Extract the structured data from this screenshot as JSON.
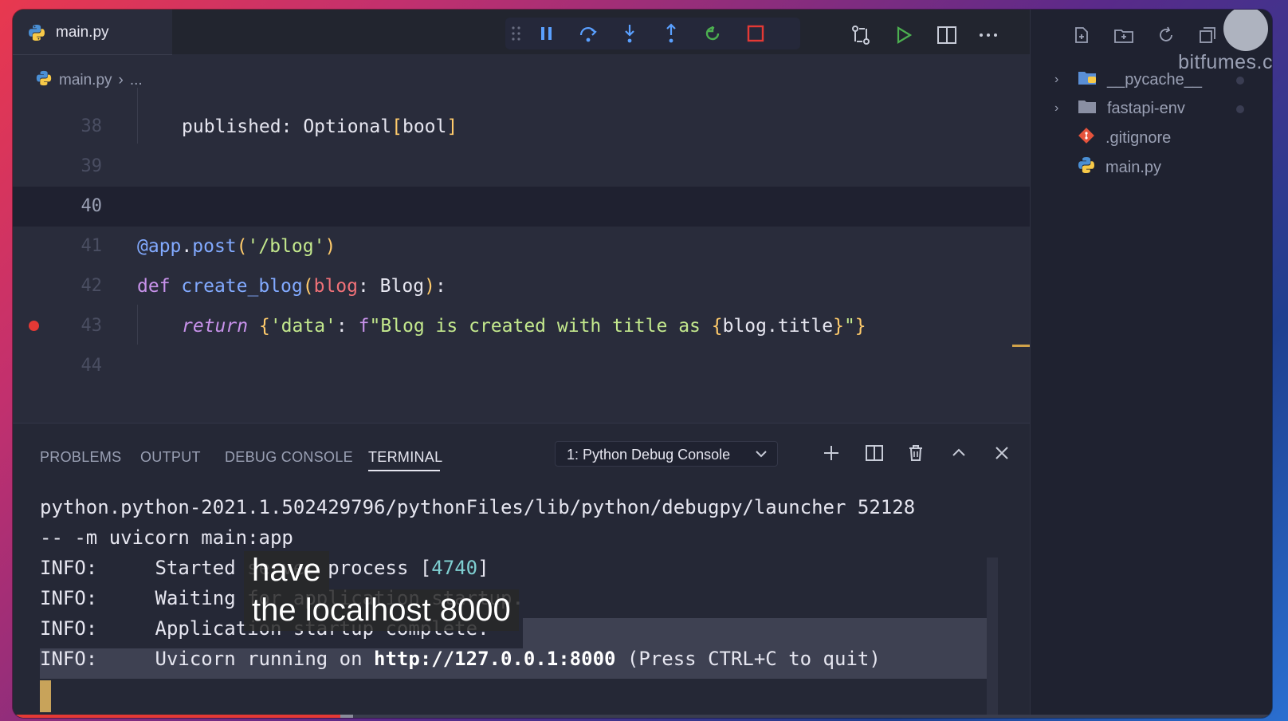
{
  "editor": {
    "tab_label": "main.py",
    "breadcrumb": {
      "file": "main.py",
      "more": "..."
    },
    "lines": [
      {
        "num": "38",
        "text": "published: Optional[bool]"
      },
      {
        "num": "39",
        "text": ""
      },
      {
        "num": "40",
        "text": ""
      },
      {
        "num": "41",
        "text": "@app.post('/blog')"
      },
      {
        "num": "42",
        "text": "def create_blog(blog: Blog):"
      },
      {
        "num": "43",
        "text": "return {'data': f\"Blog is created with title as {blog.title}\"}"
      },
      {
        "num": "44",
        "text": ""
      }
    ],
    "current_line": "40",
    "breakpoint_line": "43"
  },
  "debug_toolbar": {
    "items": [
      "drag-handle-icon",
      "pause-icon",
      "step-over-icon",
      "step-into-icon",
      "step-out-icon",
      "restart-icon",
      "stop-icon"
    ]
  },
  "title_actions": [
    "compare-changes-icon",
    "run-icon",
    "split-editor-icon",
    "more-actions-icon"
  ],
  "explorer": {
    "brand": "bitfumes.c",
    "items": [
      {
        "name": "__pycache__",
        "type": "folder",
        "expandable": true
      },
      {
        "name": "fastapi-env",
        "type": "folder",
        "expandable": true
      },
      {
        "name": ".gitignore",
        "type": "git"
      },
      {
        "name": "main.py",
        "type": "python"
      }
    ]
  },
  "panel": {
    "tabs": [
      "PROBLEMS",
      "OUTPUT",
      "DEBUG CONSOLE",
      "TERMINAL"
    ],
    "active_tab": "TERMINAL",
    "terminal_select": "1: Python Debug Console",
    "terminal_lines": {
      "l1": "python.python-2021.1.502429796/pythonFiles/lib/python/debugpy/launcher 52128",
      "l2": "-- -m uvicorn main:app",
      "l3_prefix": "INFO:     Started ",
      "l3_hidden": "server",
      "l3_mid": " process [",
      "l3_num": "4740",
      "l3_end": "]",
      "l4": "INFO:     Waiting for application startup.",
      "l5": "INFO:     Application startup complete.",
      "l6_prefix": "INFO:     Uvicorn running on ",
      "l6_url": "http://127.0.0.1:8000",
      "l6_suffix": " (Press CTRL+C to quit)"
    }
  },
  "captions": {
    "line1": "have",
    "line2": "the localhost 8000"
  },
  "video_progress": {
    "played_fraction": 0.26,
    "buffered_fraction": 0.27
  }
}
